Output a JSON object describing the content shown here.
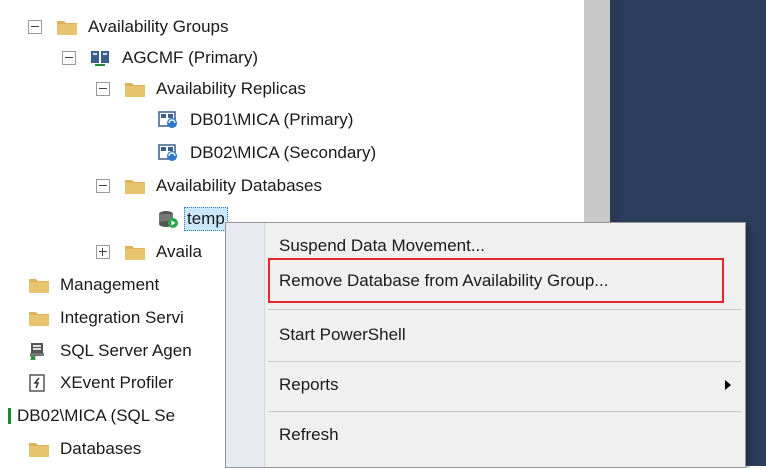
{
  "tree": {
    "availability_groups": "Availability Groups",
    "agcmf": "AGCMF (Primary)",
    "availability_replicas": "Availability Replicas",
    "replica1": "DB01\\MICA (Primary)",
    "replica2": "DB02\\MICA (Secondary)",
    "availability_databases": "Availability Databases",
    "db_temp": "temp",
    "availability_listeners": "Availa",
    "management": "Management",
    "integration_services": "Integration Servi",
    "sql_server_agent": "SQL Server Agen",
    "xevent_profiler": "XEvent Profiler",
    "server_node": "DB02\\MICA (SQL Se",
    "databases": "Databases"
  },
  "context_menu": {
    "suspend": "Suspend Data Movement...",
    "remove": "Remove Database from Availability Group...",
    "powershell": "Start PowerShell",
    "reports": "Reports",
    "refresh": "Refresh"
  },
  "colors": {
    "folder": "#dcb35c",
    "highlight": "#e32626",
    "selection": "#cce8ff",
    "right_pane": "#2b3d5c"
  }
}
